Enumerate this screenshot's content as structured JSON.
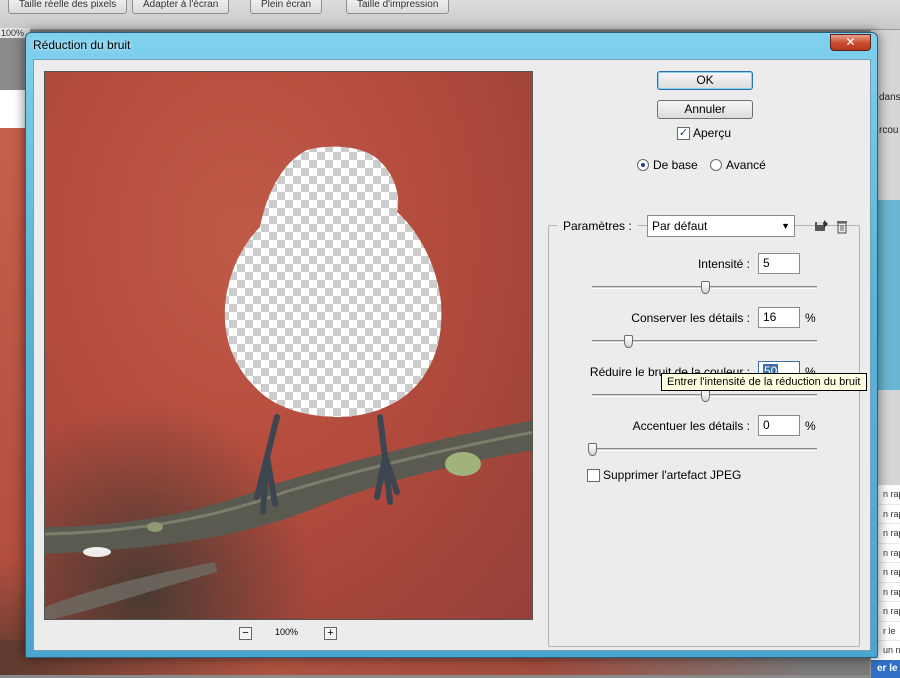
{
  "app_toolbar": {
    "buttons": [
      "Taille réelle des pixels",
      "Adapter à l'écran",
      "Plein écran",
      "Taille d'impression"
    ],
    "doc_zoom": "100%"
  },
  "right_panel": {
    "texts": [
      "dans",
      "rcou"
    ],
    "list_items": [
      "n rap",
      "n rap",
      "n rap",
      "n rap",
      "n rap",
      "n rap",
      "n rap",
      "r le",
      "un n"
    ],
    "selected_item": "er le"
  },
  "dialog": {
    "title": "Réduction du bruit",
    "close_glyph": "✕",
    "ok_label": "OK",
    "cancel_label": "Annuler",
    "preview_label": "Aperçu",
    "preview_checked": true,
    "mode_basic_label": "De base",
    "mode_advanced_label": "Avancé",
    "mode_selected": "basic",
    "zoom": {
      "minus": "−",
      "plus": "+",
      "level": "100%"
    },
    "settings": {
      "label": "Paramètres :",
      "value": "Par défaut",
      "arrow": "▼",
      "save_icon": "save-icon",
      "delete_icon": "trash-icon"
    },
    "sliders": [
      {
        "label": "Intensité :",
        "value": "5",
        "unit": "",
        "level": 0.5
      },
      {
        "label": "Conserver les détails :",
        "value": "16",
        "unit": "%",
        "level": 0.16
      },
      {
        "label": "Réduire le bruit de la couleur :",
        "value": "50",
        "unit": "%",
        "level": 0.5
      },
      {
        "label": "Accentuer les détails :",
        "value": "0",
        "unit": "%",
        "level": 0.0
      }
    ],
    "jpeg_label": "Supprimer l'artefact JPEG",
    "jpeg_checked": false,
    "tooltip": "Entrer l'intensité de la réduction du bruit"
  },
  "colors": {
    "dialog_frame": "#5cb4d8",
    "background_photo": "#b44c3d",
    "selection": "#3a6ea5"
  }
}
